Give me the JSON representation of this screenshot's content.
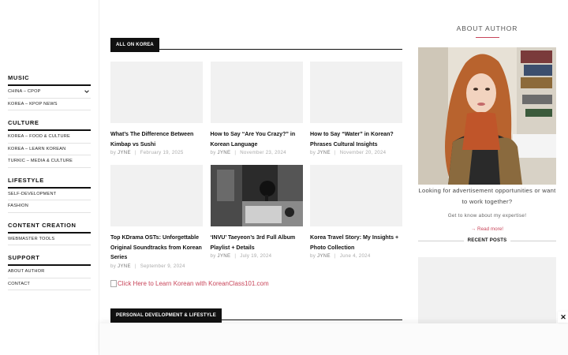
{
  "sidebar": {
    "sections": [
      {
        "title": "MUSIC",
        "items": [
          "CHINA – CPOP",
          "KOREA – KPOP NEWS"
        ]
      },
      {
        "title": "CULTURE",
        "items": [
          "KOREA – FOOD & CULTURE",
          "KOREA – LEARN KOREAN",
          "TURKIC – MEDIA & CULTURE"
        ]
      },
      {
        "title": "LIFESTYLE",
        "items": [
          "SELF-DEVELOPMENT",
          "FASHION"
        ]
      },
      {
        "title": "CONTENT CREATION",
        "items": [
          "WEBMASTER TOOLS"
        ]
      },
      {
        "title": "SUPPORT",
        "items": [
          "ABOUT AUTHOR",
          "CONTACT"
        ]
      }
    ]
  },
  "main": {
    "section1_label": "ALL ON KOREA",
    "posts": [
      {
        "title": "What’s The Difference Between Kimbap vs Sushi",
        "author": "JYNE",
        "date": "February 19, 2025"
      },
      {
        "title": "How to Say “Are You Crazy?” in Korean Language",
        "author": "JYNE",
        "date": "November 23, 2024"
      },
      {
        "title": "How to Say “Water” in Korean? Phrases Cultural Insights",
        "author": "JYNE",
        "date": "November 20, 2024"
      },
      {
        "title": "Top KDrama OSTs: Unforgettable Original Soundtracks from Korean Series",
        "author": "JYNE",
        "date": "September 9, 2024"
      },
      {
        "title": "‘INVU’ Taeyeon’s 3rd Full Album Playlist + Details",
        "author": "JYNE",
        "date": "July 19, 2024"
      },
      {
        "title": "Korea Travel Story: My Insights + Photo Collection",
        "author": "JYNE",
        "date": "June 4, 2024"
      }
    ],
    "by_label": "by",
    "banner_text": "Click Here to Learn Korean with KoreanClass101.com",
    "section2_label": "PERSONAL DEVELOPMENT & LIFESTYLE"
  },
  "right": {
    "about_title": "ABOUT AUTHOR",
    "about_text": "Looking for advertisement opportunities or want to work together?",
    "about_sub": "Get to know about my expertise!",
    "read_more": "→ Read more!",
    "recent_posts": "RECENT POSTS"
  },
  "overlay": {
    "close": "✕"
  },
  "colors": {
    "accent": "#c8455a",
    "dark": "#111111"
  }
}
